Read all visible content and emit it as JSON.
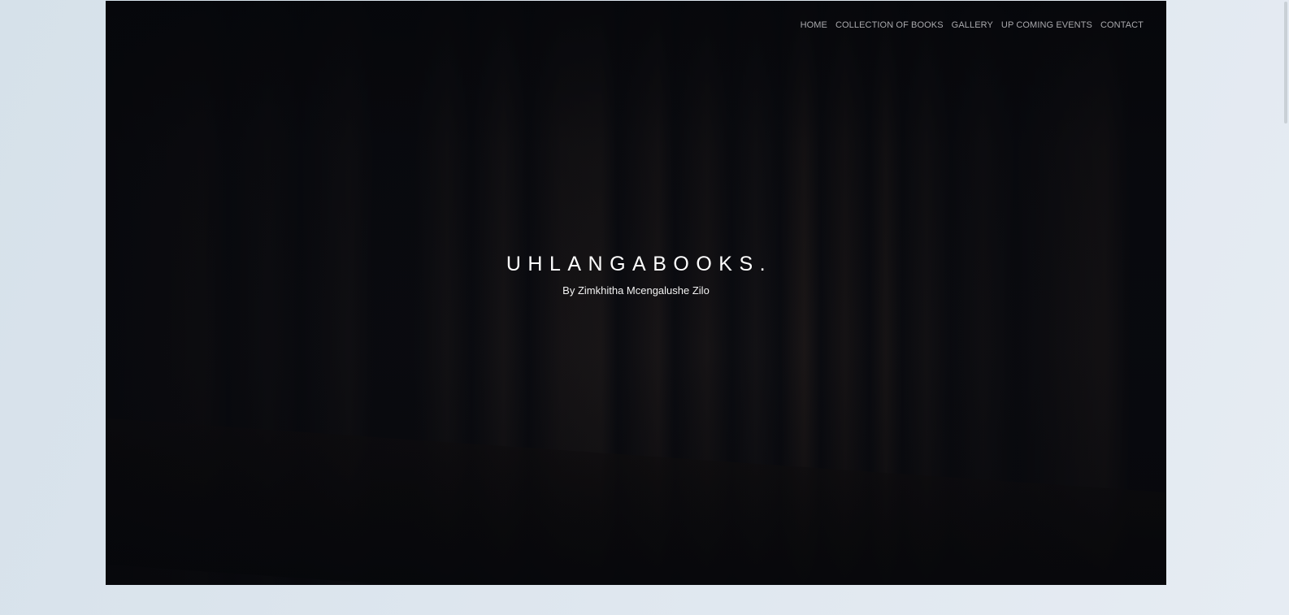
{
  "nav": {
    "items": [
      {
        "label": "HOME"
      },
      {
        "label": "COLLECTION OF BOOKS"
      },
      {
        "label": "GALLERY"
      },
      {
        "label": "UP COMING EVENTS"
      },
      {
        "label": "CONTACT"
      }
    ]
  },
  "hero": {
    "title": "UHLANGABOOKS.",
    "subtitle": "By Zimkhitha Mcengalushe Zilo"
  },
  "colors": {
    "page_background": "#dde6ee",
    "hero_background": "#0b0c11",
    "nav_text": "#a9a9ad",
    "title_text": "#ffffff"
  }
}
